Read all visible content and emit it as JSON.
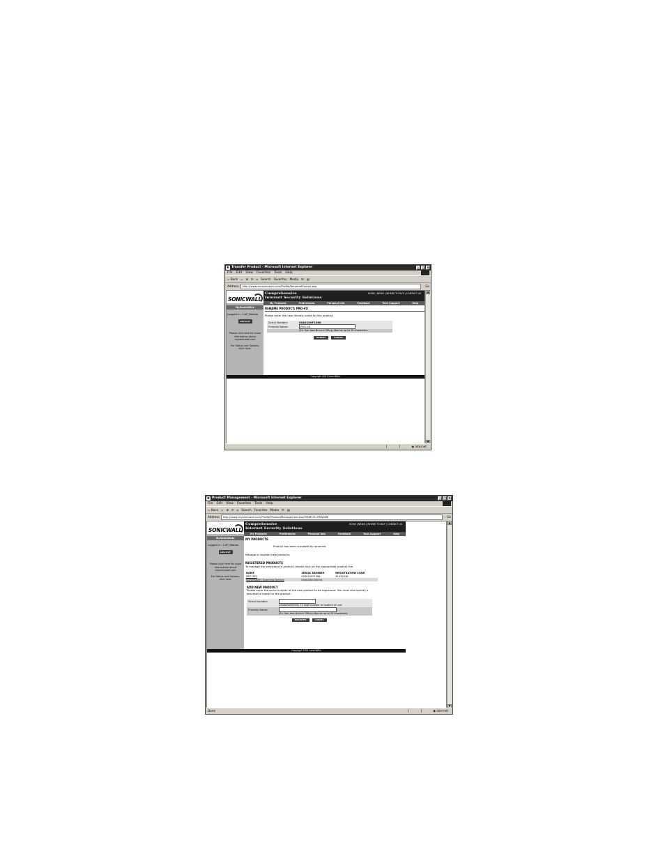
{
  "screen1": {
    "window_title": "Transfer Product - Microsoft Internet Explorer",
    "menu": [
      "File",
      "Edit",
      "View",
      "Favorites",
      "Tools",
      "Help"
    ],
    "toolbar": [
      "⇦ Back",
      "⇨",
      "⊗",
      "⟳",
      "⌂",
      "Search",
      "Favorites",
      "Media",
      "✉",
      "▤"
    ],
    "address_label": "Address",
    "address_value": "http://www.mysonicwall.com/Profile/RenameProduct.asp",
    "go_label": "Go",
    "status_text": "",
    "zone_text": "Internet",
    "site": {
      "logo": "SONICWALL",
      "banner_line1": "Comprehensive",
      "banner_line2": "Internet Security Solutions",
      "top_links": "HOME | NEWS | WHERE TO BUY | CONTACT US",
      "nav": [
        "My Products",
        "Preferences",
        "Personal Info",
        "Feedback",
        "Tech Support",
        "Help"
      ],
      "sidebar_title": "MySonicWALL",
      "logged_in": "Logged in : LAP_Wentw",
      "logout": "LOG OUT",
      "side_text": "Please click here for more information about mysonicwall.com",
      "side_text2": "For Status and Options, click here.",
      "footer": "Copyright 2001 SonicWALL"
    },
    "rename": {
      "heading": "RENAME PRODUCT: PRO-VX",
      "instructions": "Please enter the new friendly name for the product.",
      "serial_label": "Serial Number:",
      "serial_value": "0040100F1566",
      "friendly_label": "Friendly Name:",
      "friendly_value": "PRO-VX",
      "hint": "(Ex. San Jose Branch Office) Max be up to 30 characters.",
      "submit": "SUBMIT",
      "cancel": "CANCEL"
    }
  },
  "screen2": {
    "window_title": "Product Management - Microsoft Internet Explorer",
    "menu": [
      "File",
      "Edit",
      "View",
      "Favorites",
      "Tools",
      "Help"
    ],
    "toolbar": [
      "⇦ Back",
      "⇨",
      "⊗",
      "⟳",
      "⌂",
      "Search",
      "Favorites",
      "Media",
      "✉",
      "▤"
    ],
    "address_label": "Address",
    "address_value": "http://www.mysonicwall.com/Profile/ProductManagement.asp?STATUS=RENAME",
    "go_label": "Go",
    "status_text": "Done",
    "zone_text": "Internet",
    "site": {
      "logo": "SONICWALL",
      "banner_line1": "Comprehensive",
      "banner_line2": "Internet Security Solutions",
      "top_links": "HOME | NEWS | WHERE TO BUY | CONTACT US",
      "nav": [
        "My Products",
        "Preferences",
        "Personal Info",
        "Feedback",
        "Tech Support",
        "Help"
      ],
      "sidebar_title": "MySonicWALL",
      "logged_in": "Logged in : LAP_Wentw",
      "logout": "LOG OUT",
      "side_text": "Please click here for more information about mysonicwall.com",
      "side_text2": "For Status and Options, click here.",
      "footer": "Copyright 2001 SonicWALL"
    },
    "products": {
      "heading": "MY PRODUCTS",
      "success": "Product has been successfully renamed.",
      "manage_text": "Manage or register new products:",
      "registered_heading": "REGISTERED PRODUCTS",
      "registered_text": "To manage the services of a product, please click on the appropriate product line.",
      "columns": [
        "NAME",
        "SERIAL NUMBER",
        "REGISTRATION CODE"
      ],
      "rows": [
        [
          "PRO-330",
          "0040100F1566",
          "81435436"
        ],
        [
          "Vulnerability Scanning Service",
          "0040000000034",
          ""
        ]
      ],
      "add_heading": "ADD NEW PRODUCT",
      "add_text": "Please enter the serial number of the new product to be registered. You must also specify a descriptive name for the product.",
      "serial_label": "Serial Number:",
      "serial_hint": "(004000000000) 12 digit number on bottom of unit.",
      "friendly_label": "Friendly Name:",
      "friendly_hint": "(Ex. San Jose Branch Office) May be up to 30 characters.",
      "register": "REGISTER",
      "cancel": "CANCEL"
    }
  }
}
